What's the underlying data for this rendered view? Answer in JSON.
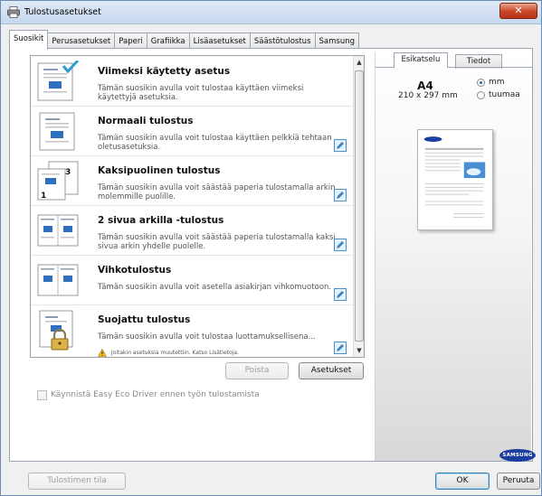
{
  "window": {
    "title": "Tulostusasetukset",
    "close_glyph": "✕"
  },
  "tabs": [
    "Suosikit",
    "Perusasetukset",
    "Paperi",
    "Grafiikka",
    "Lisäasetukset",
    "Säästötulostus",
    "Samsung"
  ],
  "favorites": {
    "items": [
      {
        "title": "Viimeksi käytetty asetus",
        "desc": "Tämän suosikin avulla voit tulostaa käyttäen viimeksi käytettyjä asetuksia."
      },
      {
        "title": "Normaali tulostus",
        "desc": "Tämän suosikin avulla voit tulostaa käyttäen pelkkiä tehtaan oletusasetuksia."
      },
      {
        "title": "Kaksipuolinen tulostus",
        "desc": "Tämän suosikin avulla voit säästää paperia tulostamalla arkin molemmille puolille."
      },
      {
        "title": "2 sivua arkilla -tulostus",
        "desc": "Tämän suosikin avulla voit säästää paperia tulostamalla kaksi sivua arkin yhdelle puolelle."
      },
      {
        "title": "Vihkotulostus",
        "desc": "Tämän suosikin avulla voit asetella asiakirjan vihkomuotoon."
      },
      {
        "title": "Suojattu tulostus",
        "desc": "Tämän suosikin avulla voit tulostaa luottamuksellisena...",
        "warning": "Joitakin asetuksia muutettiin. Katso Lisätietoja."
      }
    ],
    "delete_label": "Poista",
    "settings_label": "Asetukset"
  },
  "eco_driver_label": "Käynnistä Easy Eco Driver ennen työn tulostamista",
  "preview": {
    "tabs": [
      "Esikatselu",
      "Tiedot"
    ],
    "paper_name": "A4",
    "paper_dims": "210 x 297 mm",
    "unit_options": [
      "mm",
      "tuumaa"
    ],
    "unit_selected": "mm",
    "logo_text": "SAMSUNG"
  },
  "footer": {
    "printer_status_label": "Tulostimen tila",
    "ok_label": "OK",
    "cancel_label": "Peruuta"
  }
}
